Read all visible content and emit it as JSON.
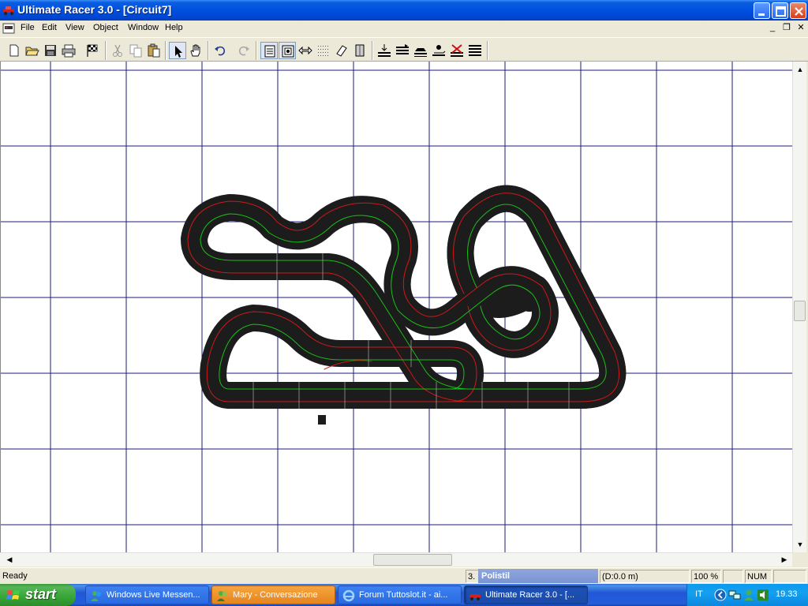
{
  "window": {
    "title": "Ultimate Racer 3.0 - [Circuit7]"
  },
  "menu": {
    "items": [
      "File",
      "Edit",
      "View",
      "Object",
      "Window",
      "Help"
    ]
  },
  "status": {
    "ready": "Ready",
    "position_text": "3.",
    "tooltip": "Polistil",
    "distance": "(D:0.0 m)",
    "zoom": "100 %",
    "num": "NUM"
  },
  "taskbar": {
    "start_label": "start",
    "tasks": [
      "Windows Live Messen...",
      "Mary - Conversazione",
      "Forum Tuttoslot.it - ai...",
      "Ultimate Racer 3.0 - [..."
    ],
    "language": "IT",
    "clock": "19.33"
  },
  "colors": {
    "grid_line": "#1c1c7a",
    "track_surface": "#1c1c1c",
    "lane_red": "#d01818",
    "lane_green": "#18c018",
    "titlebar": "#0050e0"
  }
}
